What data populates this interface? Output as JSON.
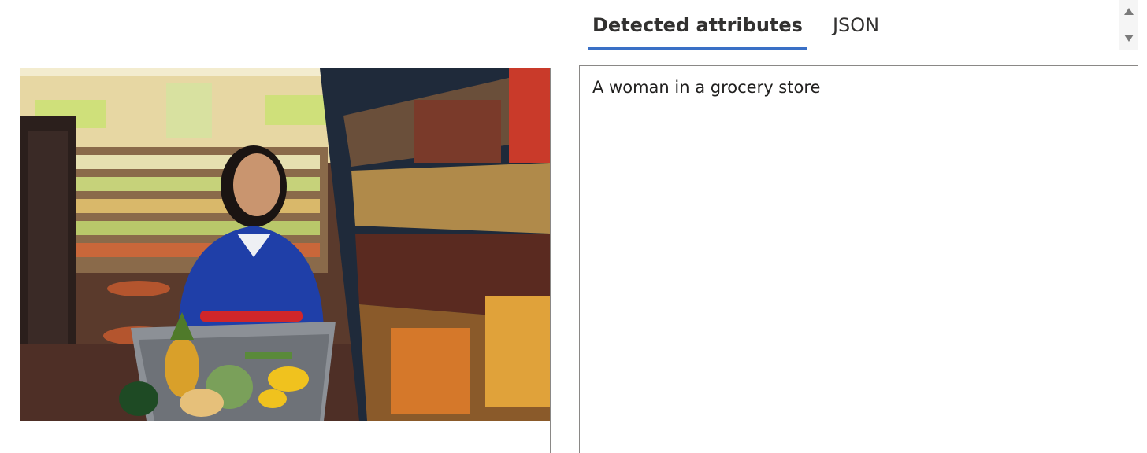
{
  "tabs": [
    {
      "label": "Detected attributes",
      "selected": true
    },
    {
      "label": "JSON",
      "selected": false
    }
  ],
  "result": {
    "caption": "A woman in a grocery store"
  },
  "image": {
    "subject": "woman-pushing-shopping-cart-in-grocery-aisle"
  },
  "colors": {
    "accent": "#3a70c6",
    "border": "#8a8886"
  }
}
